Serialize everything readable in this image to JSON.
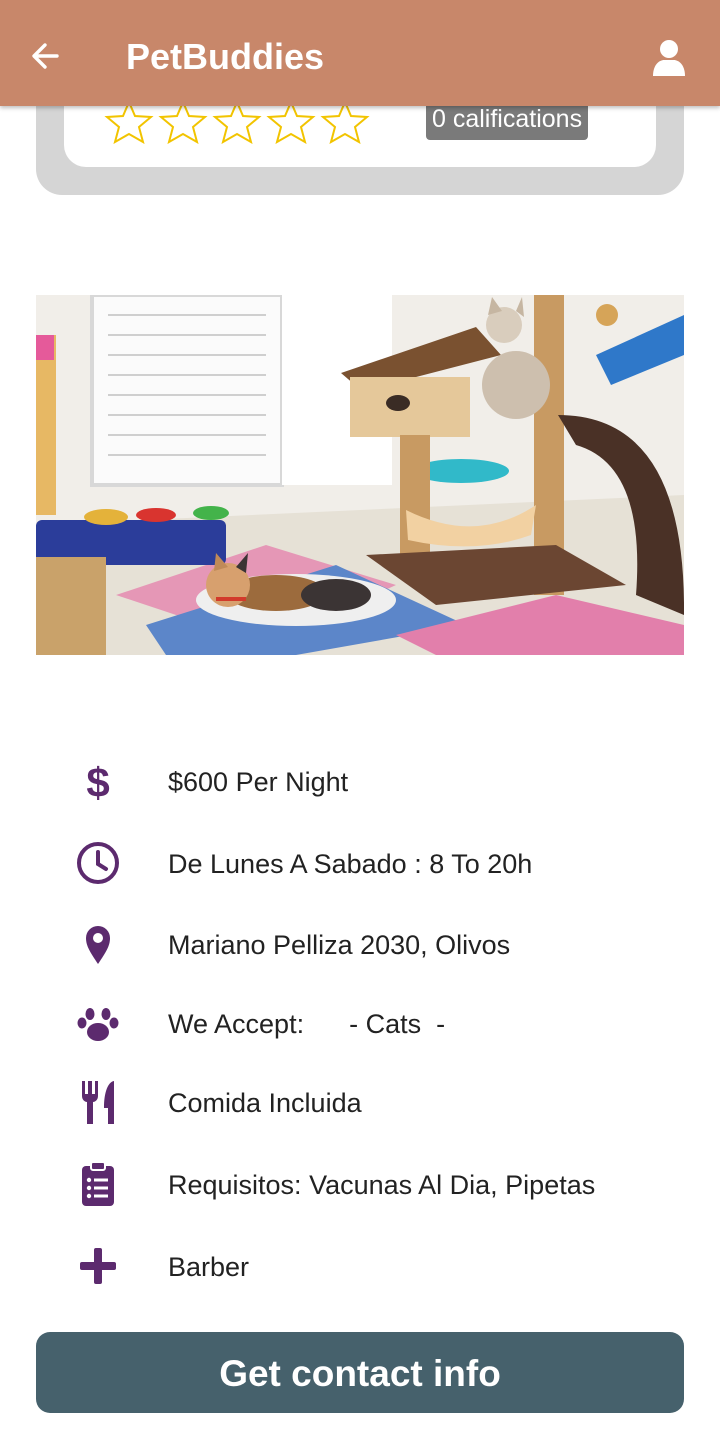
{
  "app": {
    "title": "PetBuddies"
  },
  "header": {
    "back_icon": "arrow-left-icon",
    "account_icon": "user-icon"
  },
  "rating": {
    "stars_filled": 0,
    "stars_total": 5,
    "califications_text": "0 califications",
    "star_color": "#f2c400"
  },
  "photo": {
    "subject": "cat-hotel-room"
  },
  "details": {
    "price": "$600 Per Night",
    "schedule": "De Lunes A Sabado : 8 To 20h",
    "address": "Mariano Pelliza 2030, Olivos",
    "accepts": "We Accept:      - Cats  -",
    "food": "Comida Incluida",
    "requirements": "Requisitos: Vacunas Al Dia, Pipetas",
    "extra": "Barber"
  },
  "icons": {
    "price": "dollar-icon",
    "schedule": "clock-icon",
    "address": "map-pin-icon",
    "accepts": "paw-icon",
    "food": "utensils-icon",
    "requirements": "clipboard-list-icon",
    "extra": "plus-icon",
    "color": "#5c2a6e"
  },
  "actions": {
    "contact_label": "Get contact info"
  },
  "colors": {
    "header": "#c8876a",
    "button": "#46616c",
    "accent": "#5c2a6e"
  }
}
